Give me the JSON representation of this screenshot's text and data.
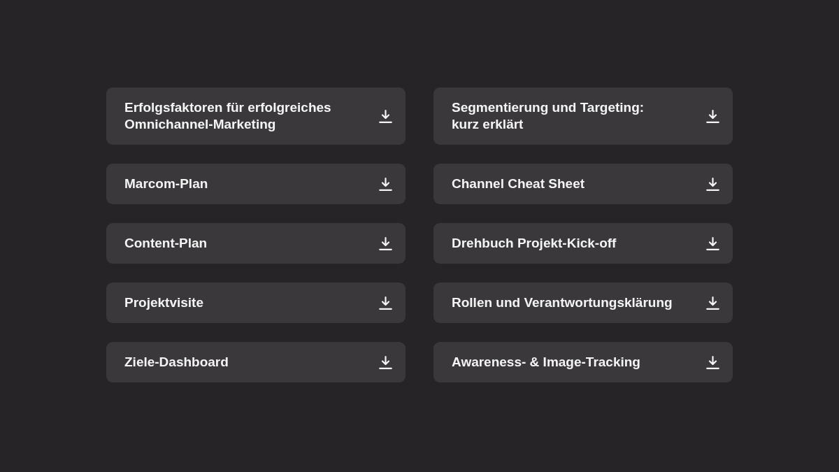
{
  "downloads": [
    {
      "title": "Erfolgsfaktoren für erfolgreiches\nOmnichannel-Marketing"
    },
    {
      "title": "Segmentierung und Targeting:\nkurz erklärt"
    },
    {
      "title": "Marcom-Plan"
    },
    {
      "title": "Channel Cheat Sheet"
    },
    {
      "title": "Content-Plan"
    },
    {
      "title": "Drehbuch Projekt-Kick-off"
    },
    {
      "title": "Projektvisite"
    },
    {
      "title": "Rollen und Verantwortungsklärung"
    },
    {
      "title": "Ziele-Dashboard"
    },
    {
      "title": "Awareness- & Image-Tracking"
    }
  ]
}
